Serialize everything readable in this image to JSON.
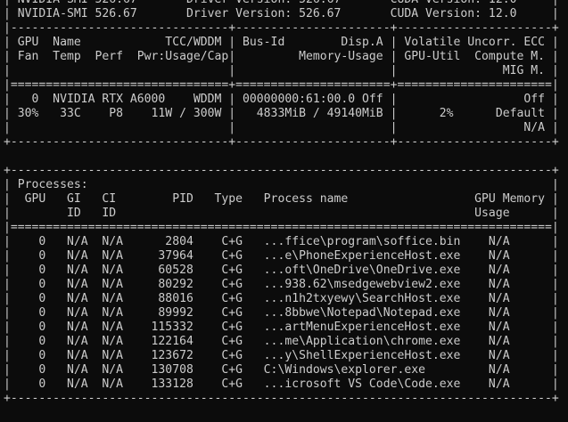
{
  "terminal": {
    "background": "#0c0c0c",
    "foreground": "#cccccc",
    "lines": [
      "| NVIDIA-SMI 526.67       Driver Version: 526.67       CUDA Version: 12.0     |",
      "| NVIDIA-SMI 526.67       Driver Version: 526.67       CUDA Version: 12.0     |",
      "|-------------------------------+----------------------+----------------------+",
      "| GPU  Name            TCC/WDDM | Bus-Id        Disp.A | Volatile Uncorr. ECC |",
      "| Fan  Temp  Perf  Pwr:Usage/Cap|         Memory-Usage | GPU-Util  Compute M. |",
      "|                               |                      |               MIG M. |",
      "|===============================+======================+======================|",
      "|   0  NVIDIA RTX A6000    WDDM | 00000000:61:00.0 Off |                  Off |",
      "| 30%   33C    P8    11W / 300W |   4833MiB / 49140MiB |      2%      Default |",
      "|                               |                      |                  N/A |",
      "+-------------------------------+----------------------+----------------------+",
      "",
      "+-----------------------------------------------------------------------------+",
      "| Processes:                                                                  |",
      "|  GPU   GI   CI        PID   Type   Process name                  GPU Memory |",
      "|        ID   ID                                                   Usage      |",
      "|=============================================================================|",
      "|    0   N/A  N/A      2804    C+G   ...ffice\\program\\soffice.bin    N/A      |",
      "|    0   N/A  N/A     37964    C+G   ...e\\PhoneExperienceHost.exe    N/A      |",
      "|    0   N/A  N/A     60528    C+G   ...oft\\OneDrive\\OneDrive.exe    N/A      |",
      "|    0   N/A  N/A     80292    C+G   ...938.62\\msedgewebview2.exe    N/A      |",
      "|    0   N/A  N/A     88016    C+G   ...n1h2txyewy\\SearchHost.exe    N/A      |",
      "|    0   N/A  N/A     89992    C+G   ...8bbwe\\Notepad\\Notepad.exe    N/A      |",
      "|    0   N/A  N/A    115332    C+G   ...artMenuExperienceHost.exe    N/A      |",
      "|    0   N/A  N/A    122164    C+G   ...me\\Application\\chrome.exe    N/A      |",
      "|    0   N/A  N/A    123672    C+G   ...y\\ShellExperienceHost.exe    N/A      |",
      "|    0   N/A  N/A    130708    C+G   C:\\Windows\\explorer.exe         N/A      |",
      "|    0   N/A  N/A    133128    C+G   ...icrosoft VS Code\\Code.exe    N/A      |",
      "+-----------------------------------------------------------------------------+"
    ]
  }
}
